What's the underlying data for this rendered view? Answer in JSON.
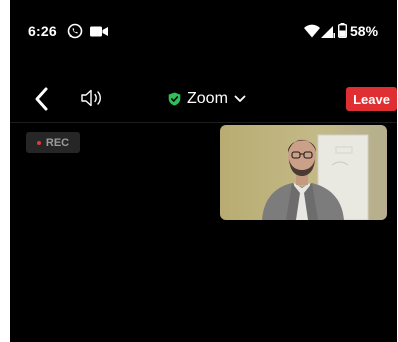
{
  "status_bar": {
    "time": "6:26",
    "battery_percent": "58%",
    "icons": [
      "whatsapp-icon",
      "video-camera-icon",
      "wifi-icon",
      "signal-icon",
      "battery-icon"
    ]
  },
  "toolbar": {
    "back_icon": "chevron-left-icon",
    "speaker_icon": "speaker-icon",
    "meeting_title": "Zoom",
    "security_icon": "shield-check-icon",
    "leave_label": "Leave"
  },
  "recording": {
    "label": "REC"
  },
  "colors": {
    "background": "#000000",
    "leave_button": "#e02f32",
    "security_shield": "#2fbe5a",
    "rec_dot": "#e0393b",
    "rec_badge": "#262626"
  }
}
